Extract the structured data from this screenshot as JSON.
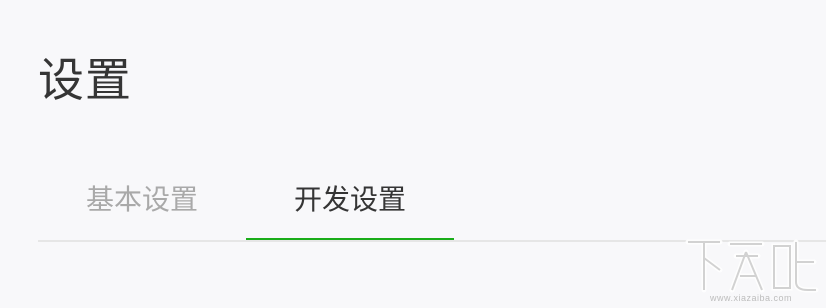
{
  "header": {
    "title": "设置"
  },
  "tabs": [
    {
      "label": "基本设置",
      "active": false
    },
    {
      "label": "开发设置",
      "active": true
    }
  ],
  "colors": {
    "accent": "#1aad19",
    "title_text": "#353535",
    "inactive_tab_text": "#a9a9a9",
    "divider": "#e6e6e6",
    "background": "#f8f8fa"
  },
  "watermark": {
    "logo_text": "下载吧",
    "url_text": "www.xiazaiba.com"
  }
}
